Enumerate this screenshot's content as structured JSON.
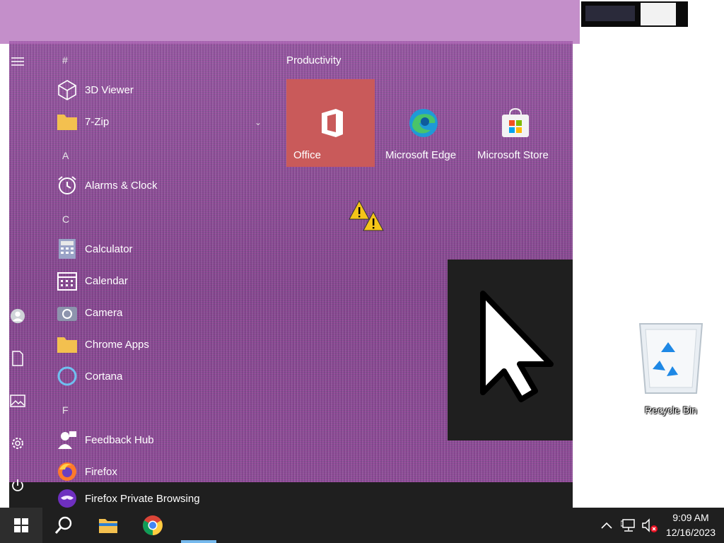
{
  "start_menu": {
    "group_title": "Productivity",
    "sections": [
      {
        "letter": "#",
        "apps": [
          "3D Viewer",
          "7-Zip"
        ]
      },
      {
        "letter": "A",
        "apps": [
          "Alarms & Clock"
        ]
      },
      {
        "letter": "C",
        "apps": [
          "Calculator",
          "Calendar",
          "Camera",
          "Chrome Apps",
          "Cortana"
        ]
      },
      {
        "letter": "F",
        "apps": [
          "Feedback Hub",
          "Firefox",
          "Firefox Private Browsing"
        ]
      }
    ],
    "tiles": [
      {
        "label": "Office",
        "icon": "office-icon",
        "color": "#c95a5a"
      },
      {
        "label": "Microsoft Edge",
        "icon": "edge-icon"
      },
      {
        "label": "Microsoft Store",
        "icon": "store-icon"
      }
    ],
    "rail_icons": [
      "hamburger-menu-icon",
      "user-icon",
      "documents-icon",
      "pictures-icon",
      "settings-icon",
      "power-icon"
    ]
  },
  "desktop": {
    "recycle_bin_label": "Recycle Bin"
  },
  "taskbar": {
    "buttons": [
      "start-icon",
      "search-icon",
      "file-explorer-icon",
      "chrome-icon"
    ],
    "tray_icons": [
      "chevron-up-icon",
      "network-icon",
      "volume-muted-icon"
    ],
    "time": "9:09 AM",
    "date": "12/16/2023"
  },
  "colors": {
    "taskbar": "#1f1f1f",
    "accent": "#76b9ed",
    "office_tile": "#c95a5a",
    "noise_overlay": "#8a4a8f"
  }
}
